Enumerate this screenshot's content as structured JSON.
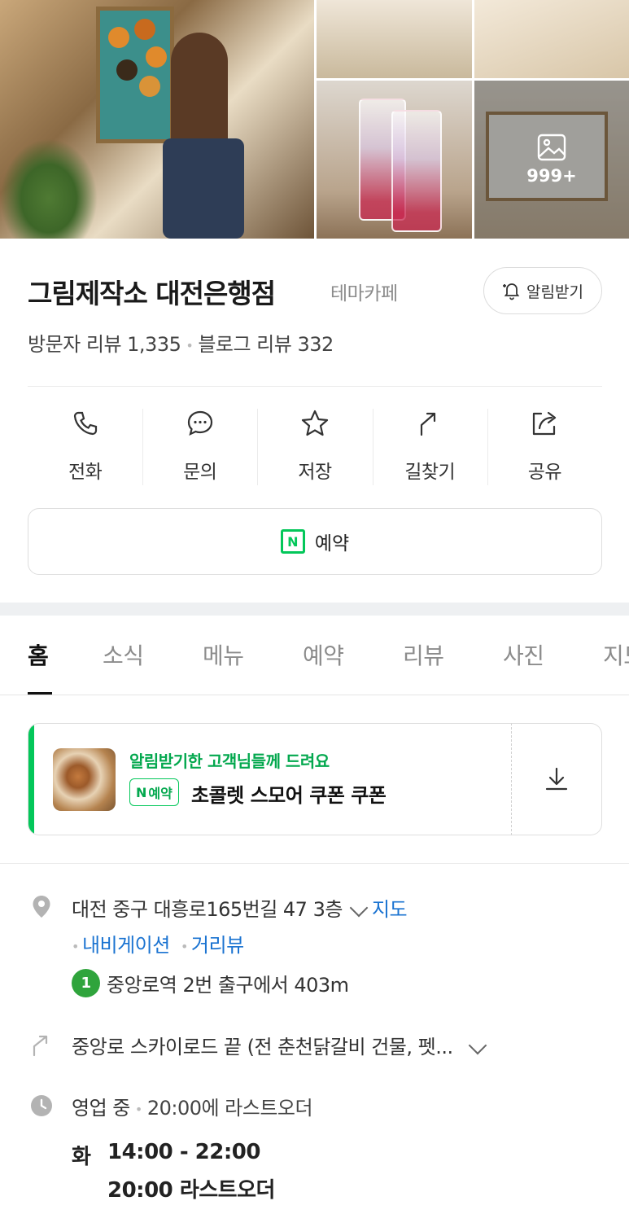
{
  "photos": {
    "more_count": "999+"
  },
  "place": {
    "name": "그림제작소 대전은행점",
    "category": "테마카페",
    "notify_label": "알림받기",
    "visitor_reviews": "방문자 리뷰 1,335",
    "blog_reviews": "블로그 리뷰 332"
  },
  "actions": [
    {
      "label": "전화",
      "icon": "phone-icon"
    },
    {
      "label": "문의",
      "icon": "chat-icon"
    },
    {
      "label": "저장",
      "icon": "star-icon"
    },
    {
      "label": "길찾기",
      "icon": "directions-icon"
    },
    {
      "label": "공유",
      "icon": "share-icon"
    }
  ],
  "reserve_label": "예약",
  "tabs": [
    {
      "label": "홈",
      "active": true
    },
    {
      "label": "소식"
    },
    {
      "label": "메뉴"
    },
    {
      "label": "예약"
    },
    {
      "label": "리뷰"
    },
    {
      "label": "사진"
    },
    {
      "label": "지도"
    }
  ],
  "coupon": {
    "subtitle": "알림받기한 고객님들께 드려요",
    "tag": "예약",
    "tag_n": "N",
    "name": "초콜렛 스모어 쿠폰 쿠폰"
  },
  "info": {
    "address": "대전 중구 대흥로165번길 47 3층",
    "map_link": "지도",
    "navigation_link": "내비게이션",
    "street_view_link": "거리뷰",
    "subway_line": "1",
    "subway_text": "중앙로역 2번 출구에서 403m",
    "directions_text": "중앙로 스카이로드 끝 (전 춘천닭갈비 건물, 펫...",
    "status": "영업 중",
    "last_order_note": "20:00에 라스트오더",
    "day": "화",
    "hours": "14:00 - 22:00",
    "last_order": "20:00 라스트오더"
  },
  "colors": {
    "accent_green": "#03c75a",
    "link_blue": "#1a73d1",
    "subway_line1": "#2fa43c"
  }
}
